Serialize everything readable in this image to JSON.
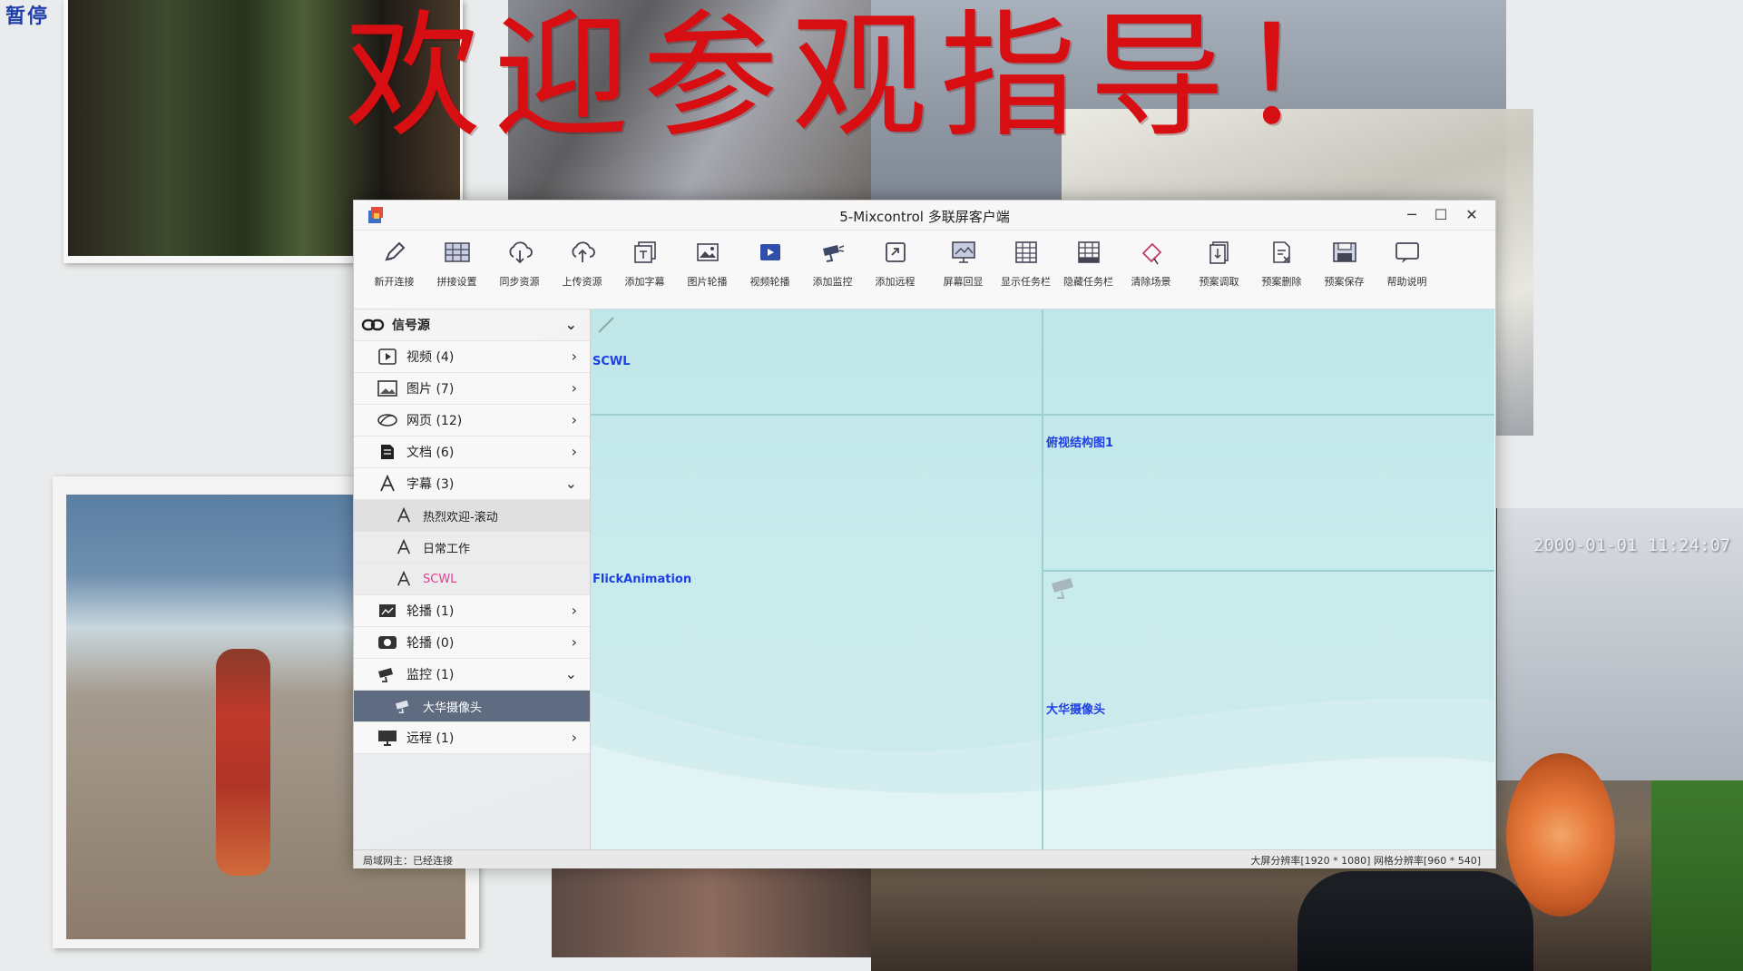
{
  "overlay": {
    "pause_label": "暂停",
    "banner_text": "欢迎参观指导！",
    "camera_timestamp": "2000-01-01 11:24:07"
  },
  "window": {
    "title": "5-Mixcontrol 多联屏客户端",
    "controls": [
      "minimize-icon",
      "maximize-icon",
      "close-icon"
    ]
  },
  "toolbar": {
    "items": [
      {
        "label": "新开连接",
        "icon": "pen-icon"
      },
      {
        "label": "拼接设置",
        "icon": "grid-panel-icon"
      },
      {
        "label": "同步资源",
        "icon": "cloud-download-icon"
      },
      {
        "label": "上传资源",
        "icon": "cloud-upload-icon"
      },
      {
        "label": "添加字幕",
        "icon": "subtitle-icon"
      },
      {
        "label": "图片轮播",
        "icon": "image-icon"
      },
      {
        "label": "视频轮播",
        "icon": "video-icon"
      },
      {
        "label": "添加监控",
        "icon": "camera-icon"
      },
      {
        "label": "添加远程",
        "icon": "remote-icon"
      },
      {
        "label": "屏幕回显",
        "icon": "screen-icon"
      },
      {
        "label": "显示任务栏",
        "icon": "taskbar-show-icon"
      },
      {
        "label": "隐藏任务栏",
        "icon": "taskbar-hide-icon"
      },
      {
        "label": "清除场景",
        "icon": "eraser-icon"
      },
      {
        "label": "预案调取",
        "icon": "plan-load-icon"
      },
      {
        "label": "预案删除",
        "icon": "plan-delete-icon"
      },
      {
        "label": "预案保存",
        "icon": "plan-save-icon"
      },
      {
        "label": "帮助说明",
        "icon": "help-icon"
      }
    ]
  },
  "sidebar": {
    "root_label": "信号源",
    "categories": [
      {
        "label": "视频 (4)",
        "icon": "video-icon",
        "chevron": "›"
      },
      {
        "label": "图片 (7)",
        "icon": "image-icon",
        "chevron": "›"
      },
      {
        "label": "网页 (12)",
        "icon": "web-icon",
        "chevron": "›"
      },
      {
        "label": "文档 (6)",
        "icon": "document-icon",
        "chevron": "›"
      },
      {
        "label": "字幕 (3)",
        "icon": "font-icon",
        "chevron": "⌄"
      }
    ],
    "subtitle_items": [
      "热烈欢迎-滚动",
      "日常工作",
      "SCWL"
    ],
    "more_categories": [
      {
        "label": "轮播 (1)",
        "icon": "carousel-icon",
        "chevron": "›"
      },
      {
        "label": "轮播 (0)",
        "icon": "carousel-video-icon",
        "chevron": "›"
      },
      {
        "label": "监控 (1)",
        "icon": "camera-icon",
        "chevron": "⌄"
      }
    ],
    "monitor_item": "大华摄像头",
    "remote_category": {
      "label": "远程 (1)",
      "icon": "monitor-icon",
      "chevron": "›"
    }
  },
  "canvas": {
    "zone_labels": [
      "SCWL",
      "FlickAnimation",
      "俯视结构图1",
      "大华摄像头"
    ]
  },
  "status": {
    "left_text": "局域网主：已经连接",
    "right_text": "大屏分辨率[1920 * 1080] 网格分辨率[960 * 540]"
  }
}
